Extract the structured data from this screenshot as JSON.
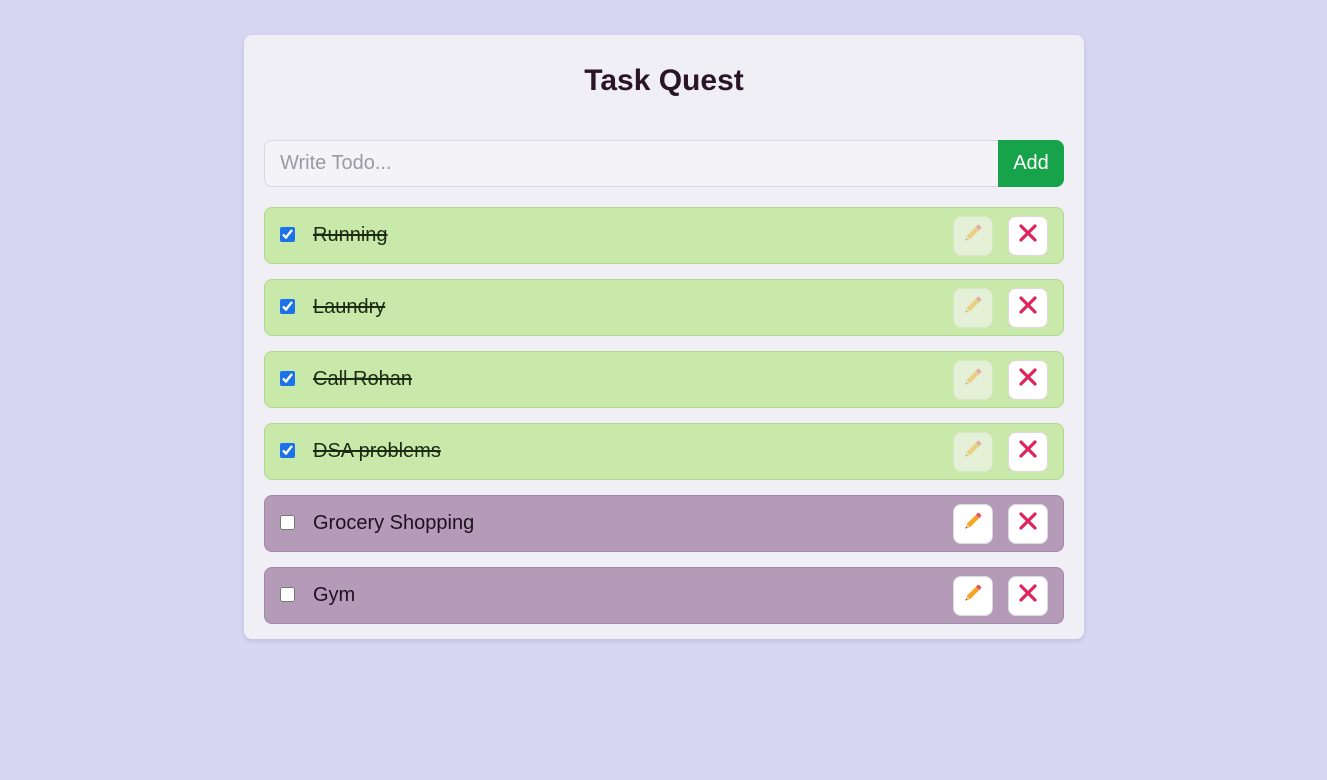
{
  "app": {
    "title": "Task Quest"
  },
  "input": {
    "placeholder": "Write Todo...",
    "value": "",
    "add_label": "Add"
  },
  "colors": {
    "background": "#d8d7f3",
    "card": "#f0eff5",
    "add_button": "#16a34a",
    "completed_item": "#c8e9a9",
    "pending_item": "#b49bb8",
    "delete_icon": "#e0245e",
    "edit_icon": "#f07d2a"
  },
  "todos": [
    {
      "text": "Running",
      "completed": true
    },
    {
      "text": "Laundry",
      "completed": true
    },
    {
      "text": "Call Rohan",
      "completed": true
    },
    {
      "text": "DSA problems",
      "completed": true
    },
    {
      "text": "Grocery Shopping",
      "completed": false
    },
    {
      "text": "Gym",
      "completed": false
    }
  ],
  "icons": {
    "edit": "pencil-icon",
    "delete": "close-icon"
  }
}
